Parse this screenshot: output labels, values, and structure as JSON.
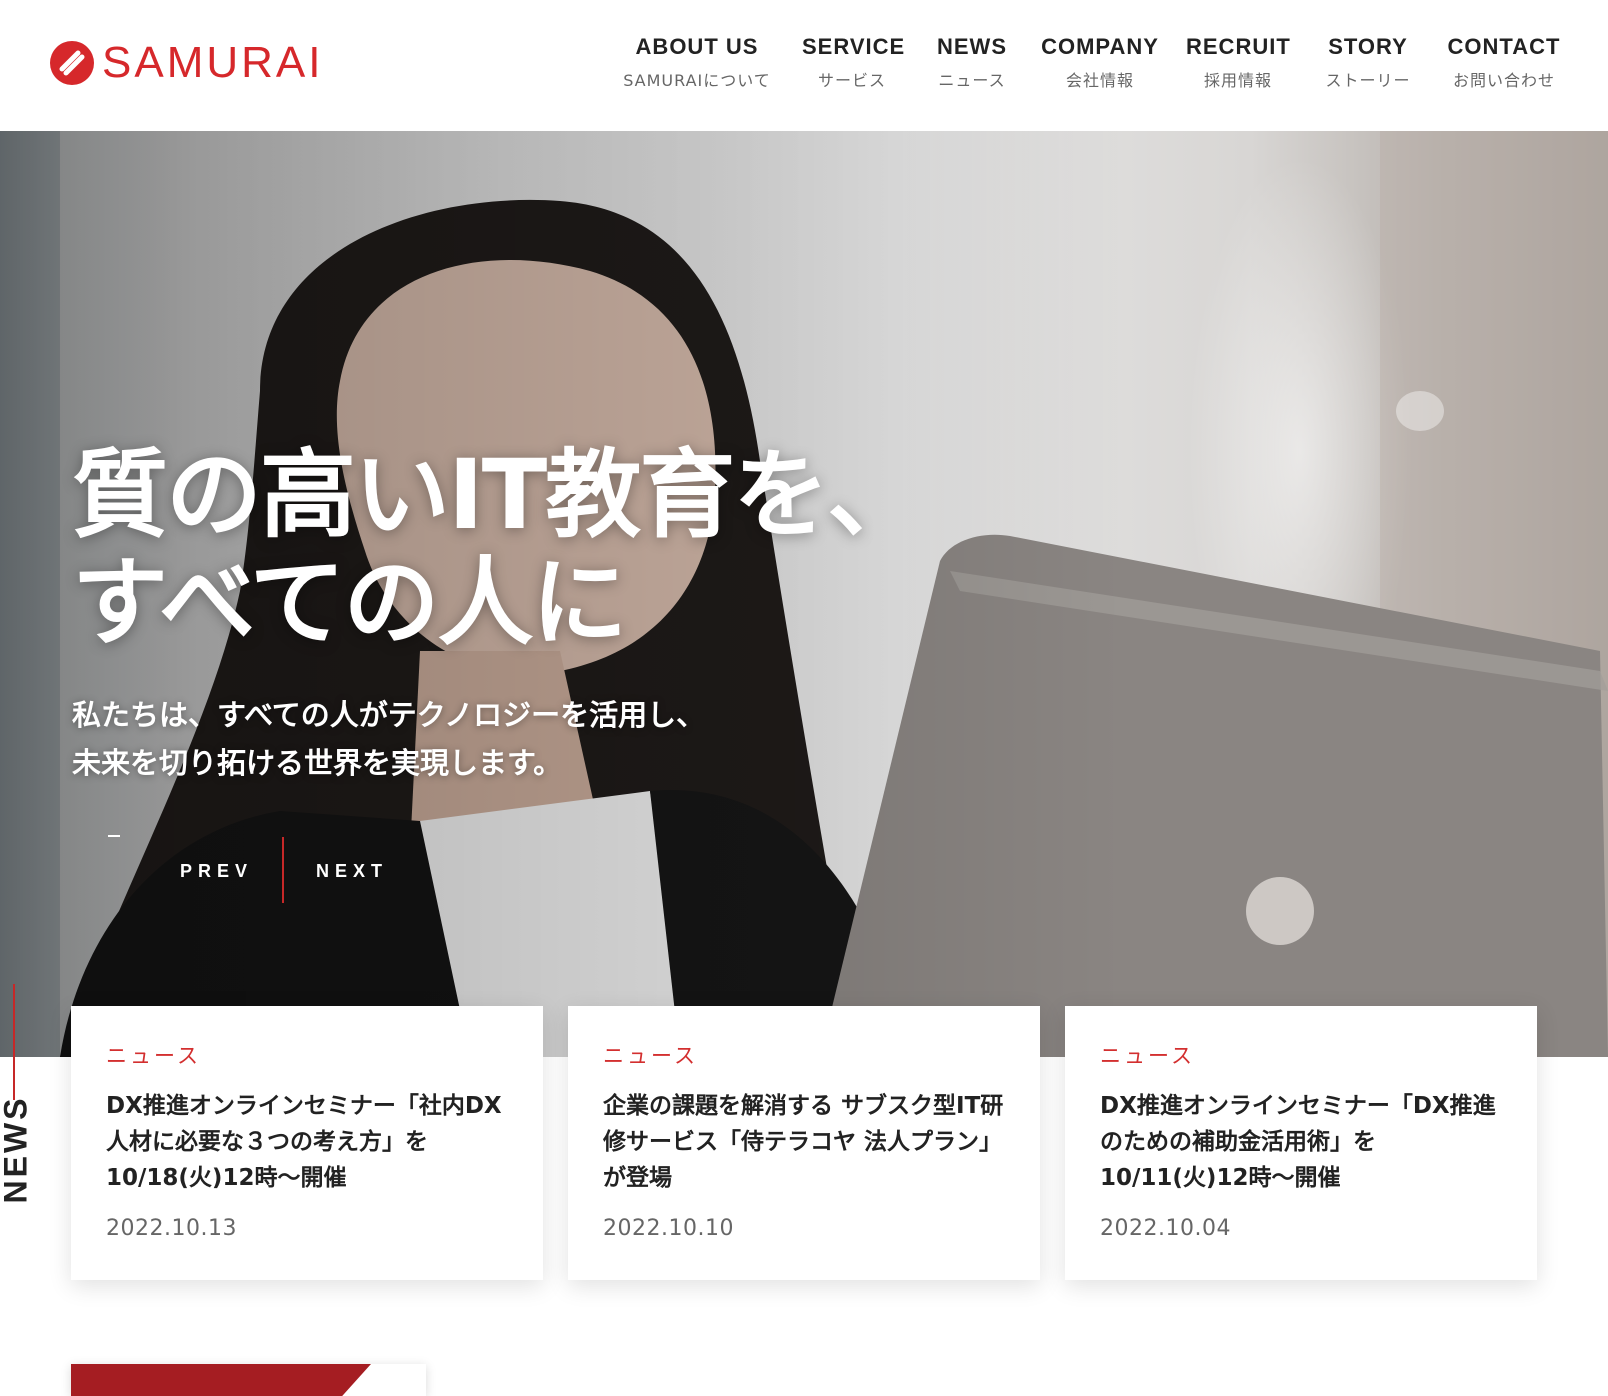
{
  "brand": {
    "name": "SAMURAI",
    "color": "#d6282b"
  },
  "nav": [
    {
      "en": "ABOUT US",
      "ja": "SAMURAIについて"
    },
    {
      "en": "SERVICE",
      "ja": "サービス"
    },
    {
      "en": "NEWS",
      "ja": "ニュース"
    },
    {
      "en": "COMPANY",
      "ja": "会社情報"
    },
    {
      "en": "RECRUIT",
      "ja": "採用情報"
    },
    {
      "en": "STORY",
      "ja": "ストーリー"
    },
    {
      "en": "CONTACT",
      "ja": "お問い合わせ"
    }
  ],
  "hero": {
    "title_lines": [
      "質の高いIT教育を、",
      "すべての人に"
    ],
    "sub_lines": [
      "私たちは、すべての人がテクノロジーを活用し、",
      "未来を切り拓ける世界を実現します。"
    ],
    "prev": "PREV",
    "next": "NEXT"
  },
  "news": {
    "label": "NEWS",
    "accent": "#c62828",
    "items": [
      {
        "category": "ニュース",
        "title": "DX推進オンラインセミナー「社内DX人材に必要な３つの考え方」を10/18(火)12時〜開催",
        "date": "2022.10.13"
      },
      {
        "category": "ニュース",
        "title": "企業の課題を解消する サブスク型IT研修サービス「侍テラコヤ 法人プラン」が登場",
        "date": "2022.10.10"
      },
      {
        "category": "ニュース",
        "title": "DX推進オンラインセミナー「DX推進のための補助金活用術」を10/11(火)12時〜開催",
        "date": "2022.10.04"
      }
    ]
  },
  "banner": {
    "color": "#a51d22"
  }
}
